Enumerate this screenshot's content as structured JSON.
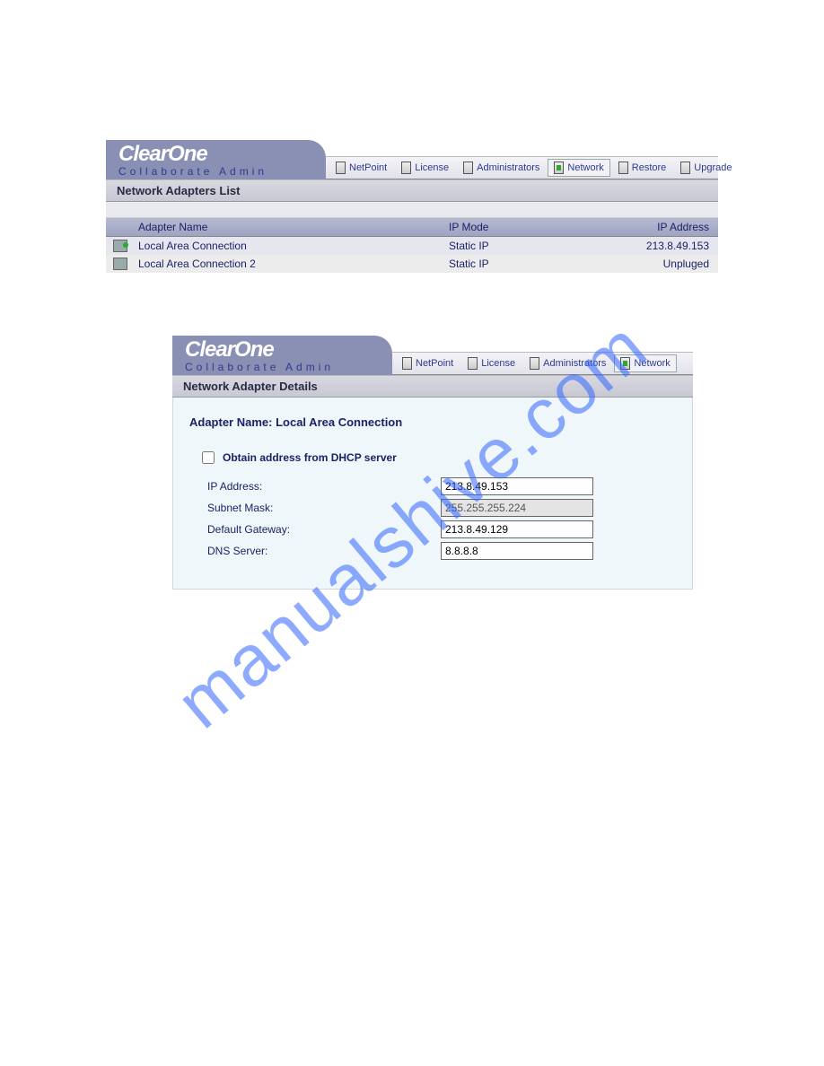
{
  "watermark": "manualshive.com",
  "brand": "ClearOne",
  "subtitle": "Collaborate Admin",
  "panel1": {
    "tabs": [
      "NetPoint",
      "License",
      "Administrators",
      "Network",
      "Restore",
      "Upgrade"
    ],
    "active_tab": "Network",
    "section_title": "Network Adapters List",
    "columns": {
      "name": "Adapter Name",
      "mode": "IP Mode",
      "ip": "IP Address"
    },
    "rows": [
      {
        "name": "Local Area Connection",
        "mode": "Static IP",
        "ip": "213.8.49.153",
        "connected": true
      },
      {
        "name": "Local Area Connection 2",
        "mode": "Static IP",
        "ip": "Unpluged",
        "connected": false
      }
    ]
  },
  "panel2": {
    "tabs": [
      "NetPoint",
      "License",
      "Administrators",
      "Network"
    ],
    "active_tab": "Network",
    "section_title": "Network Adapter Details",
    "adapter_label": "Adapter Name:",
    "adapter_value": "Local Area Connection",
    "dhcp_label": "Obtain address from DHCP server",
    "dhcp_checked": false,
    "fields": {
      "ip": {
        "label": "IP Address:",
        "value": "213.8.49.153",
        "disabled": false
      },
      "mask": {
        "label": "Subnet Mask:",
        "value": "255.255.255.224",
        "disabled": true
      },
      "gateway": {
        "label": "Default Gateway:",
        "value": "213.8.49.129",
        "disabled": false
      },
      "dns": {
        "label": "DNS Server:",
        "value": "8.8.8.8",
        "disabled": false
      }
    }
  }
}
